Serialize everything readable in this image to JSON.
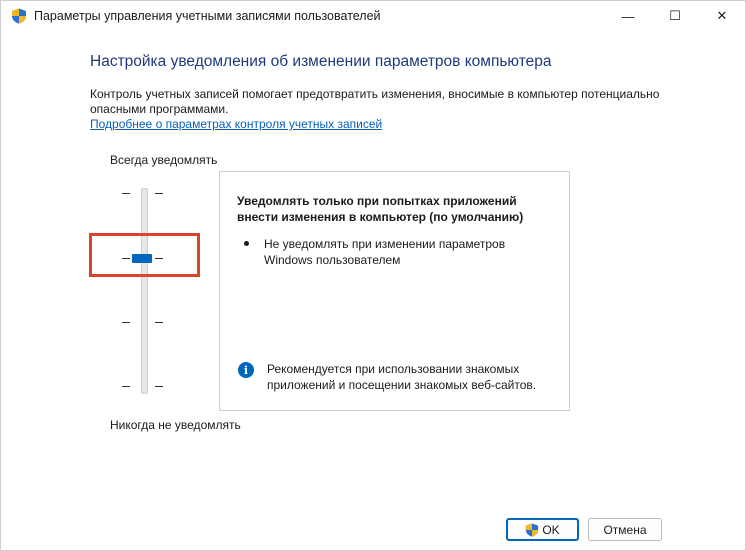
{
  "window": {
    "title": "Параметры управления учетными записями пользователей",
    "controls": {
      "minimize": "—",
      "maximize": "☐",
      "close": "✕"
    }
  },
  "main": {
    "heading": "Настройка уведомления об изменении параметров компьютера",
    "description": "Контроль учетных записей помогает предотвратить изменения, вносимые в компьютер потенциально опасными программами.",
    "link": "Подробнее о параметрах контроля учетных записей"
  },
  "slider": {
    "top_label": "Всегда уведомлять",
    "bottom_label": "Никогда не уведомлять",
    "levels": 4,
    "selected_level": 3
  },
  "info_panel": {
    "title": "Уведомлять только при попытках приложений внести изменения в компьютер (по умолчанию)",
    "bullet": "Не уведомлять при изменении параметров Windows пользователем",
    "info_icon_glyph": "i",
    "recommendation": "Рекомендуется при использовании знакомых приложений и посещении знакомых веб-сайтов."
  },
  "buttons": {
    "ok": "OK",
    "cancel": "Отмена"
  },
  "colors": {
    "accent": "#0067c0",
    "heading": "#1e3a7a",
    "link": "#0a5fb4",
    "highlight": "#d9452b"
  },
  "icons": {
    "title": "uac-shield-icon",
    "ok_button": "uac-shield-icon",
    "info": "info-icon"
  }
}
